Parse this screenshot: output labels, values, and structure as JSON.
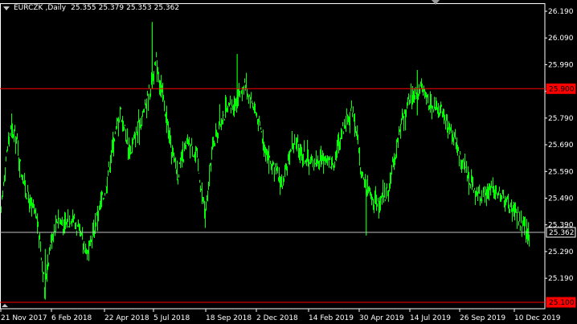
{
  "header": {
    "symbol": "EURCZK",
    "timeframe": "Daily",
    "open": "25.355",
    "high": "25.379",
    "low": "25.353",
    "close": "25.362"
  },
  "colors": {
    "background": "#000000",
    "series": "#00ff00",
    "resistance_line": "#ff0000",
    "support_line": "#ff0000",
    "current_price_line": "#c0c0c0",
    "axis": "#ffffff"
  },
  "price_labels": {
    "resistance": "25.900",
    "current": "25.362",
    "support": "25.100"
  },
  "chart_data": {
    "type": "bar",
    "title": "EURCZK,Daily",
    "ylim": [
      25.1,
      26.2
    ],
    "yticks": [
      "26.190",
      "26.090",
      "25.990",
      "25.890",
      "25.790",
      "25.690",
      "25.590",
      "25.490",
      "25.390",
      "25.290",
      "25.190"
    ],
    "xticks": [
      "21 Nov 2017",
      "6 Feb 2018",
      "22 Apr 2018",
      "5 Jul 2018",
      "18 Sep 2018",
      "2 Dec 2018",
      "14 Feb 2019",
      "30 Apr 2019",
      "14 Jul 2019",
      "26 Sep 2019",
      "10 Dec 2019"
    ],
    "horizontal_lines": [
      {
        "name": "resistance",
        "value": 25.9
      },
      {
        "name": "current",
        "value": 25.362
      },
      {
        "name": "support",
        "value": 25.1
      }
    ],
    "series": [
      {
        "close_path": [
          [
            "21 Nov 2017",
            25.4
          ],
          [
            "28 Nov 2017",
            25.62
          ],
          [
            "6 Dec 2017",
            25.75
          ],
          [
            "14 Dec 2017",
            25.72
          ],
          [
            "22 Dec 2017",
            25.58
          ],
          [
            "3 Jan 2018",
            25.47
          ],
          [
            "12 Jan 2018",
            25.42
          ],
          [
            "18 Jan 2018",
            25.32
          ],
          [
            "24 Jan 2018",
            25.16
          ],
          [
            "2 Feb 2018",
            25.33
          ],
          [
            "12 Feb 2018",
            25.42
          ],
          [
            "22 Feb 2018",
            25.38
          ],
          [
            "5 Mar 2018",
            25.43
          ],
          [
            "15 Mar 2018",
            25.36
          ],
          [
            "28 Mar 2018",
            25.28
          ],
          [
            "10 Apr 2018",
            25.42
          ],
          [
            "22 Apr 2018",
            25.52
          ],
          [
            "2 May 2018",
            25.68
          ],
          [
            "14 May 2018",
            25.82
          ],
          [
            "28 May 2018",
            25.66
          ],
          [
            "15 Jun 2018",
            25.8
          ],
          [
            "26 Jun 2018",
            25.9
          ],
          [
            "5 Jul 2018",
            26.0
          ],
          [
            "14 Jul 2018",
            25.88
          ],
          [
            "25 Jul 2018",
            25.7
          ],
          [
            "5 Aug 2018",
            25.58
          ],
          [
            "20 Aug 2018",
            25.7
          ],
          [
            "1 Sep 2018",
            25.65
          ],
          [
            "14 Sep 2018",
            25.42
          ],
          [
            "25 Sep 2018",
            25.7
          ],
          [
            "10 Oct 2018",
            25.8
          ],
          [
            "25 Oct 2018",
            25.84
          ],
          [
            "10 Nov 2018",
            25.92
          ],
          [
            "25 Nov 2018",
            25.82
          ],
          [
            "8 Dec 2018",
            25.7
          ],
          [
            "20 Dec 2018",
            25.6
          ],
          [
            "5 Jan 2019",
            25.54
          ],
          [
            "18 Jan 2019",
            25.7
          ],
          [
            "2 Feb 2019",
            25.66
          ],
          [
            "16 Feb 2019",
            25.62
          ],
          [
            "3 Mar 2019",
            25.64
          ],
          [
            "18 Mar 2019",
            25.62
          ],
          [
            "2 Apr 2019",
            25.76
          ],
          [
            "16 Apr 2019",
            25.83
          ],
          [
            "28 Apr 2019",
            25.58
          ],
          [
            "10 May 2019",
            25.5
          ],
          [
            "22 May 2019",
            25.46
          ],
          [
            "6 Jun 2019",
            25.52
          ],
          [
            "22 Jun 2019",
            25.74
          ],
          [
            "8 Jul 2019",
            25.88
          ],
          [
            "22 Jul 2019",
            25.9
          ],
          [
            "6 Aug 2019",
            25.84
          ],
          [
            "22 Aug 2019",
            25.82
          ],
          [
            "8 Sep 2019",
            25.72
          ],
          [
            "24 Sep 2019",
            25.62
          ],
          [
            "8 Oct 2019",
            25.52
          ],
          [
            "22 Oct 2019",
            25.5
          ],
          [
            "8 Nov 2019",
            25.53
          ],
          [
            "22 Nov 2019",
            25.48
          ],
          [
            "8 Dec 2019",
            25.44
          ],
          [
            "18 Dec 2019",
            25.38
          ],
          [
            "27 Dec 2019",
            25.35
          ]
        ]
      }
    ]
  }
}
